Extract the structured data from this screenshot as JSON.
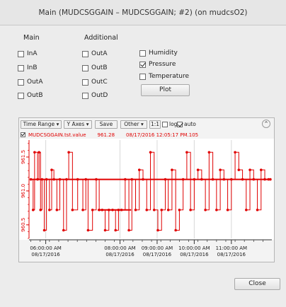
{
  "window": {
    "title": "Main (MUDCSGGAIN – MUDCSGGAIN; #2) (on mudcsO2)"
  },
  "columns": {
    "main": "Main",
    "additional": "Additional"
  },
  "main_checkboxes": [
    {
      "label": "InA",
      "checked": false
    },
    {
      "label": "InB",
      "checked": false
    },
    {
      "label": "OutA",
      "checked": false
    },
    {
      "label": "OutB",
      "checked": false
    }
  ],
  "additional_checkboxes": [
    {
      "label": "OutA",
      "checked": false
    },
    {
      "label": "OutB",
      "checked": false
    },
    {
      "label": "OutC",
      "checked": false
    },
    {
      "label": "OutD",
      "checked": false
    }
  ],
  "env_checkboxes": [
    {
      "label": "Humidity",
      "checked": false
    },
    {
      "label": "Pressure",
      "checked": true
    },
    {
      "label": "Temperature",
      "checked": false
    }
  ],
  "plot_button": "Plot",
  "toolbar": {
    "time_range": "Time Range",
    "y_axes": "Y Axes",
    "save": "Save",
    "other": "Other",
    "one_to_one": "1:1",
    "log": "log",
    "log_checked": false,
    "auto": "auto",
    "auto_checked": true,
    "collapse_icon": "double-chevron-up-icon"
  },
  "legend": {
    "name": "MUDCSGGAIN.tst.value",
    "value": "961.28",
    "timestamp": "08/17/2016 12:05:17 PM.105",
    "checked": true,
    "color": "#e00000"
  },
  "close_button": "Close",
  "chart_data": {
    "type": "line",
    "step": true,
    "color": "#e00000",
    "y_ticks": [
      "960.5",
      "961.0",
      "961.5"
    ],
    "y_tick_values": [
      960.5,
      961.0,
      961.5
    ],
    "ylim": [
      960.3,
      961.75
    ],
    "x_ticks": [
      {
        "time": "06:00:00 AM",
        "date": "08/17/2016",
        "hour": 6
      },
      {
        "time": "08:00:00 AM",
        "date": "08/17/2016",
        "hour": 8
      },
      {
        "time": "09:00:00 AM",
        "date": "08/17/2016",
        "hour": 9
      },
      {
        "time": "10:00:00 AM",
        "date": "08/17/2016",
        "hour": 10
      },
      {
        "time": "11:00:00 AM",
        "date": "08/17/2016",
        "hour": 11
      }
    ],
    "xlim_hours": [
      5.55,
      12.09
    ],
    "levels": [
      960.42,
      960.72,
      961.17,
      961.31,
      961.57
    ],
    "series": [
      {
        "hours": [
          5.6,
          5.66,
          5.7,
          5.78,
          5.82,
          5.86,
          5.9,
          5.96,
          6.02,
          6.1,
          6.16,
          6.22,
          6.3,
          6.38,
          6.48,
          6.56,
          6.62,
          6.72,
          6.86,
          7.0,
          7.08,
          7.14,
          7.26,
          7.36,
          7.44,
          7.52,
          7.6,
          7.7,
          7.8,
          7.88,
          7.96,
          8.04,
          8.14,
          8.24,
          8.32,
          8.42,
          8.52,
          8.62,
          8.72,
          8.82,
          8.92,
          9.02,
          9.12,
          9.22,
          9.3,
          9.4,
          9.5,
          9.6,
          9.7,
          9.8,
          9.9,
          10.0,
          10.1,
          10.2,
          10.3,
          10.4,
          10.5,
          10.6,
          10.7,
          10.8,
          10.9,
          11.0,
          11.1,
          11.2,
          11.3,
          11.4,
          11.5,
          11.6,
          11.7,
          11.8,
          11.9,
          12.0,
          12.05
        ],
        "values": [
          961.17,
          960.72,
          961.57,
          961.17,
          961.57,
          960.72,
          961.17,
          960.42,
          961.17,
          960.72,
          961.31,
          961.17,
          960.72,
          961.17,
          960.42,
          961.17,
          961.57,
          960.72,
          961.17,
          960.72,
          961.17,
          960.42,
          960.72,
          961.17,
          960.72,
          960.72,
          960.42,
          960.72,
          960.72,
          960.42,
          960.72,
          960.72,
          961.17,
          960.42,
          961.17,
          960.72,
          961.31,
          961.17,
          960.72,
          961.57,
          960.72,
          960.42,
          960.72,
          961.17,
          960.72,
          961.31,
          960.42,
          960.72,
          961.17,
          961.57,
          960.72,
          961.17,
          961.31,
          961.17,
          960.72,
          961.57,
          961.17,
          960.72,
          961.31,
          961.17,
          960.72,
          961.17,
          961.57,
          961.31,
          961.17,
          960.72,
          961.31,
          961.17,
          960.72,
          961.31,
          961.17,
          961.17,
          961.17
        ]
      }
    ]
  }
}
